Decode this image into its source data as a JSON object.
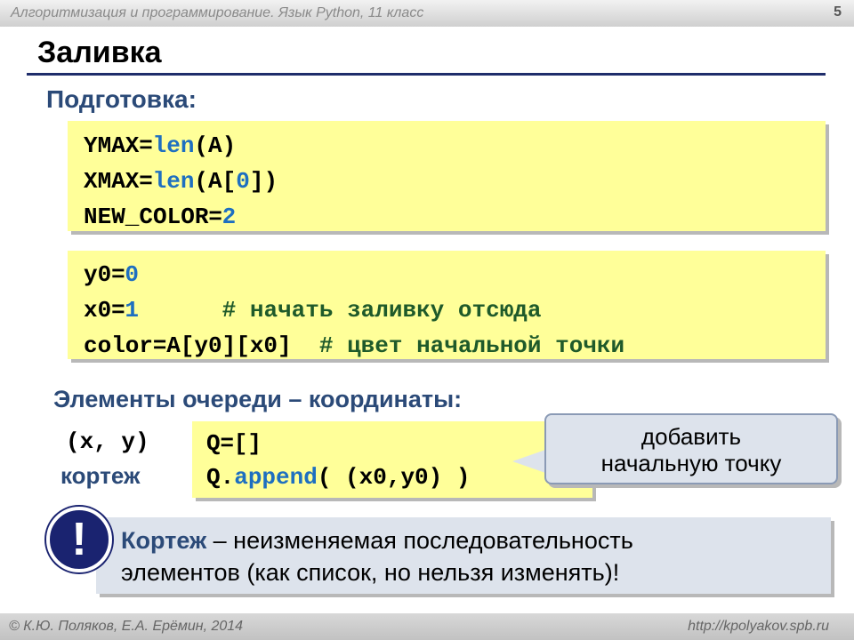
{
  "header": {
    "course": "Алгоритмизация и программирование. Язык Python, 11 класс",
    "page": "5"
  },
  "title": "Заливка",
  "prep": {
    "heading": "Подготовка:",
    "block1": {
      "l1": {
        "name": "YMAX",
        "eq": "=",
        "fn": "len",
        "args": "(A)"
      },
      "l2": {
        "name": "XMAX",
        "eq": "=",
        "fn": "len",
        "a": "(A[",
        "n": "0",
        "b": "])"
      },
      "l3": {
        "name": "NEW_COLOR",
        "eq": "=",
        "n": "2"
      }
    },
    "block2": {
      "l1": {
        "name": "y0",
        "eq": "=",
        "n": "0"
      },
      "l2": {
        "name": "x0",
        "eq": "=",
        "n": "1",
        "comment": "# начать заливку отсюда"
      },
      "l3": {
        "name": "color",
        "eq": "=",
        "expr": "A[y0][x0]",
        "comment": "# цвет начальной точки"
      }
    }
  },
  "queue": {
    "heading": "Элементы очереди – координаты:",
    "tuple": "(x, y)",
    "tuple_word": "кортеж",
    "code": {
      "l1": {
        "name": "Q",
        "eq": "=",
        "rest": "[]"
      },
      "l2": {
        "a": "Q.",
        "fn": "append",
        "b": "( (x0,y0) )"
      }
    },
    "callout": {
      "line1": "добавить",
      "line2": "начальную точку"
    }
  },
  "note": {
    "icon": "!",
    "term": "Кортеж",
    "line1_rest": " – неизменяемая последовательность",
    "line2": "элементов (как список, но нельзя изменять)!"
  },
  "footer": {
    "left": "© К.Ю. Поляков, Е.А. Ерёмин, 2014",
    "right": "http://kpolyakov.spb.ru"
  }
}
